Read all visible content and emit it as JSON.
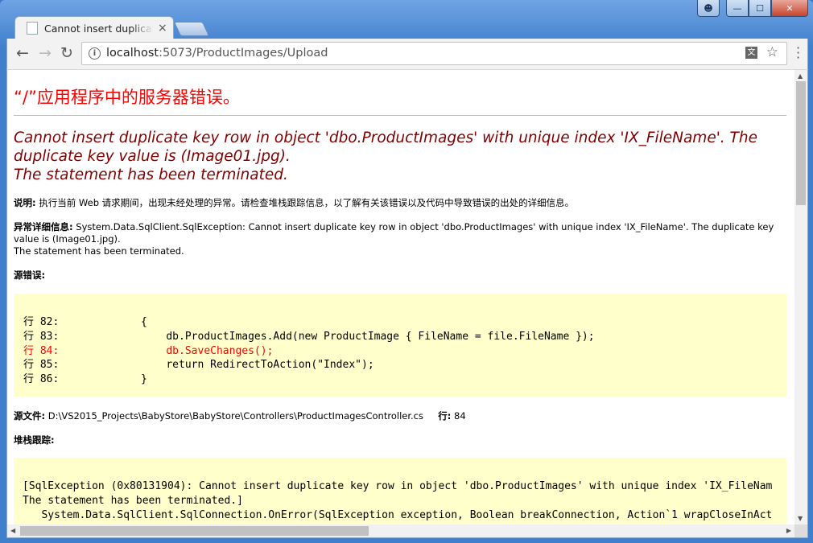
{
  "window": {
    "controls": {
      "user": "user-icon",
      "minimize": "—",
      "maximize": "☐",
      "close": "✕"
    }
  },
  "tab": {
    "title": "Cannot insert duplicate key row",
    "close": "×"
  },
  "nav": {
    "back": "←",
    "forward": "→",
    "reload": "↻"
  },
  "address": {
    "host": "localhost",
    "rest": ":5073/ProductImages/Upload"
  },
  "page": {
    "heading": "“/”应用程序中的服务器错误。",
    "error_title_line1": "Cannot insert duplicate key row in object 'dbo.ProductImages' with unique index 'IX_FileName'. The",
    "error_title_line2": "duplicate key value is (Image01.jpg).",
    "error_title_line3": "The statement has been terminated.",
    "desc_label": "说明:",
    "desc_text": " 执行当前 Web 请求期间，出现未经处理的异常。请检查堆栈跟踪信息，以了解有关该错误以及代码中导致错误的出处的详细信息。",
    "exception_label": "异常详细信息:",
    "exception_text": " System.Data.SqlClient.SqlException: Cannot insert duplicate key row in object 'dbo.ProductImages' with unique index 'IX_FileName'. The duplicate key value is (Image01.jpg).",
    "exception_text2": "The statement has been terminated.",
    "source_error_label": "源错误:",
    "source_lines": [
      {
        "text": "行 82:             {",
        "highlight": false
      },
      {
        "text": "行 83:                 db.ProductImages.Add(new ProductImage { FileName = file.FileName });",
        "highlight": false
      },
      {
        "text": "行 84:                 db.SaveChanges();",
        "highlight": true
      },
      {
        "text": "行 85:                 return RedirectToAction(\"Index\");",
        "highlight": false
      },
      {
        "text": "行 86:             }",
        "highlight": false
      }
    ],
    "source_file_label": "源文件:",
    "source_file_path": " D:\\VS2015_Projects\\BabyStore\\BabyStore\\Controllers\\ProductImagesController.cs",
    "line_label": "行:",
    "line_number": " 84",
    "stack_label": "堆栈跟踪:",
    "stack_lines": [
      "[SqlException (0x80131904): Cannot insert duplicate key row in object 'dbo.ProductImages' with unique index 'IX_FileNam",
      "The statement has been terminated.]",
      "   System.Data.SqlClient.SqlConnection.OnError(SqlException exception, Boolean breakConnection, Action`1 wrapCloseInAct"
    ]
  }
}
